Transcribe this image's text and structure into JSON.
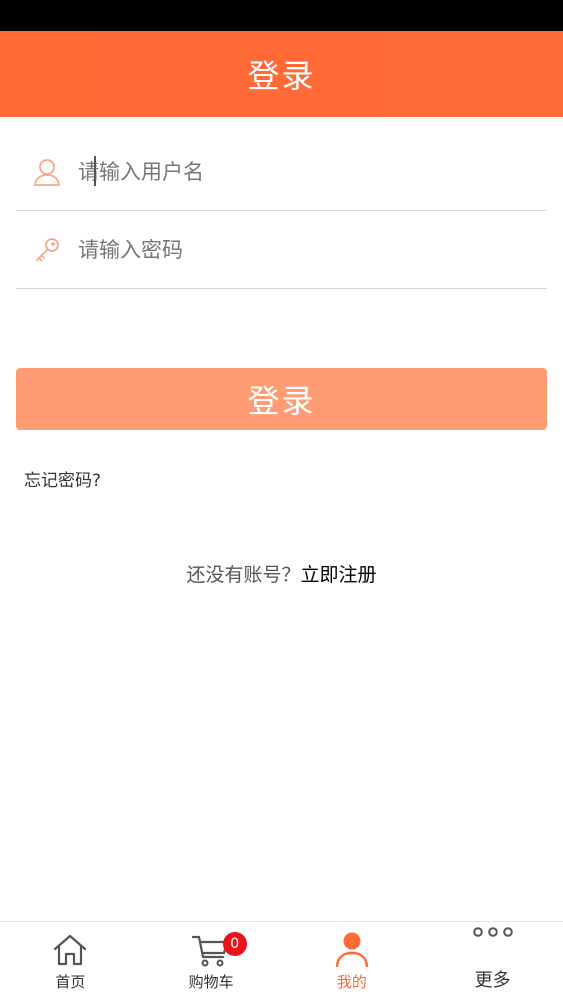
{
  "header": {
    "title": "登录"
  },
  "form": {
    "username_placeholder": "请输入用户名",
    "password_placeholder": "请输入密码",
    "login_label": "登录",
    "forgot_label": "忘记密码?",
    "register_prompt": "还没有账号？",
    "register_link": "立即注册"
  },
  "tabbar": {
    "items": [
      {
        "label": "首页",
        "icon": "home-icon"
      },
      {
        "label": "购物车",
        "icon": "cart-icon",
        "badge": "0"
      },
      {
        "label": "我的",
        "icon": "user-icon",
        "active": true
      },
      {
        "label": "更多",
        "icon": "more-icon"
      }
    ]
  },
  "colors": {
    "accent": "#ff6a35",
    "button": "#ff9c73",
    "badge": "#e8141c"
  }
}
